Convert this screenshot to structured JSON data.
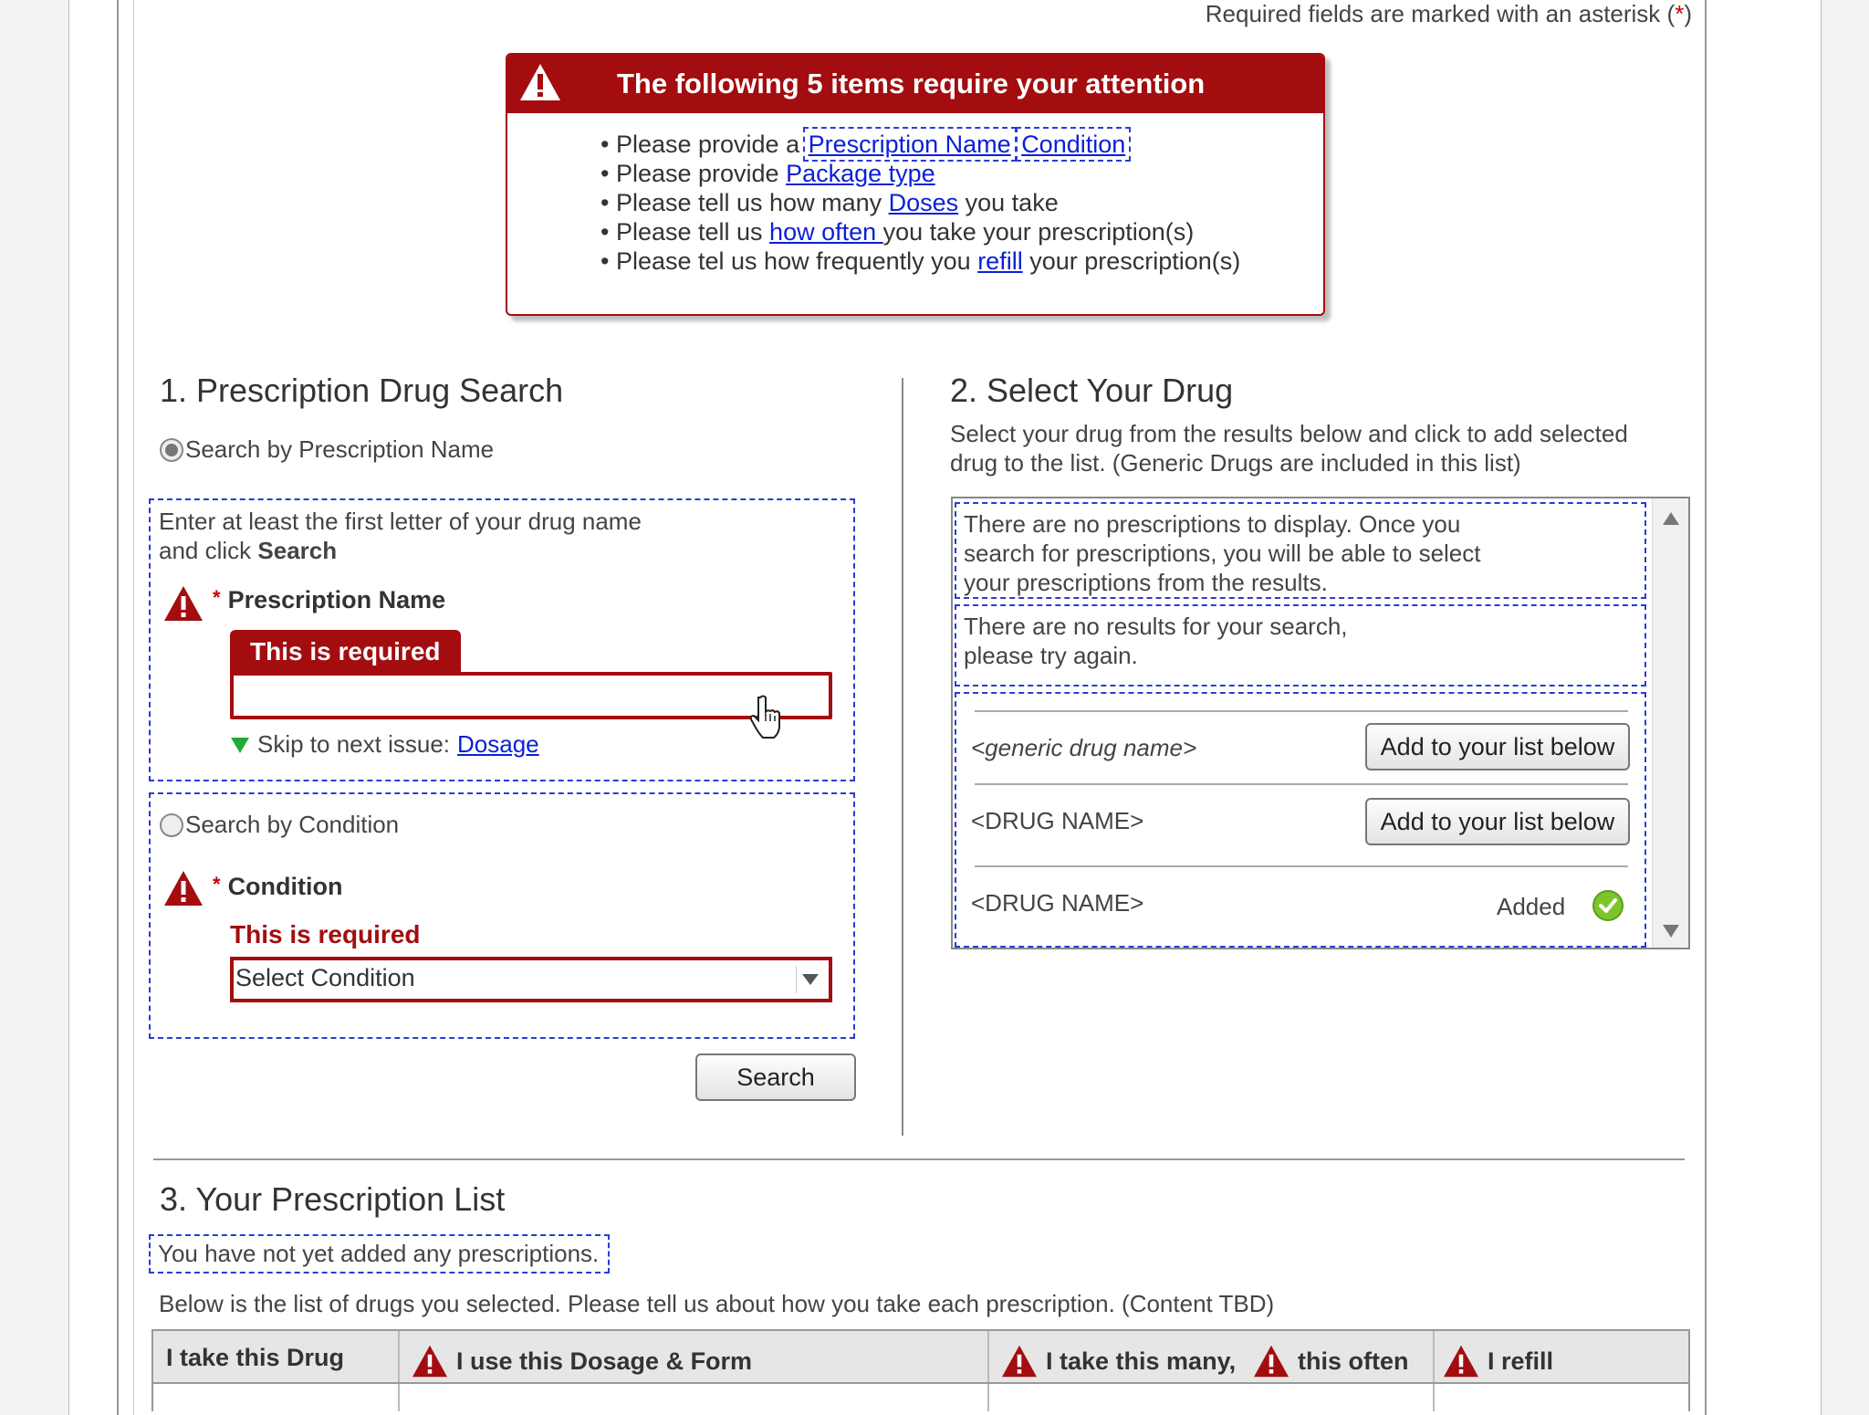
{
  "required_note": {
    "text": "Required fields are marked with an asterisk (",
    "asterisk": "*",
    "close": ")"
  },
  "alert": {
    "title": "The following 5 items require your attention",
    "items": [
      {
        "prefix": "• Please provide a ",
        "links": [
          "Prescription Name",
          "Condition"
        ],
        "suffix": ""
      },
      {
        "prefix": "• Please provide ",
        "links": [
          "Package type"
        ],
        "suffix": ""
      },
      {
        "prefix": "• Please tell us how many ",
        "links": [
          "Doses"
        ],
        "suffix": " you take"
      },
      {
        "prefix": "• Please tell us ",
        "links": [
          "how often "
        ],
        "suffix": "you take your prescription(s)"
      },
      {
        "prefix": "• Please tel us how frequently you ",
        "links": [
          "refill"
        ],
        "suffix": " your prescription(s)"
      }
    ]
  },
  "section1": {
    "title": "1. Prescription Drug Search",
    "radio_name": "Search by Prescription Name",
    "instructions_line1": "Enter at least the first letter of your drug name",
    "instructions_line2_prefix": "and click ",
    "instructions_line2_bold": "Search",
    "asterisk": "*",
    "prescription_label": "Prescription Name",
    "required_tab": "This is required",
    "prescription_value": "",
    "skip_prefix": "Skip to next issue: ",
    "skip_link": "Dosage",
    "radio_condition": "Search by Condition",
    "condition_label": "Condition",
    "condition_required": "This is required",
    "condition_select": "Select Condition",
    "search_button": "Search"
  },
  "section2": {
    "title": "2. Select Your Drug",
    "desc_line1": "Select your drug from the results below and click to add selected",
    "desc_line2": "drug to the list. (Generic Drugs are included in this list)",
    "empty_lines": [
      "There are no prescriptions to display. Once you",
      "search for prescriptions, you will be able to select",
      "your prescriptions from the results."
    ],
    "no_results_lines": [
      "There are no results for your search,",
      "please try again."
    ],
    "rows": [
      {
        "name": "<generic drug name>",
        "action": "Add to your list below"
      },
      {
        "name": "<DRUG NAME>",
        "action": "Add to your list below"
      },
      {
        "name": "<DRUG NAME>",
        "status": "Added"
      }
    ]
  },
  "section3": {
    "title": "3. Your Prescription List",
    "empty_note": "You have not yet added any prescriptions.",
    "desc": "Below is the list of drugs you selected. Please tell us about how you take each prescription. (Content TBD)",
    "columns": [
      "I take this Drug",
      "I use this Dosage & Form",
      "I take this many,",
      "this often",
      "I  refill"
    ]
  },
  "colors": {
    "error": "#a30d10",
    "link": "#0b1fd8",
    "annotation": "#2a3bd6",
    "success": "#66bb22"
  },
  "icons": {
    "warning": "warning-triangle-icon",
    "arrow": "green-down-arrow-icon",
    "check": "check-circle-icon",
    "cursor": "hand-pointer-icon"
  }
}
